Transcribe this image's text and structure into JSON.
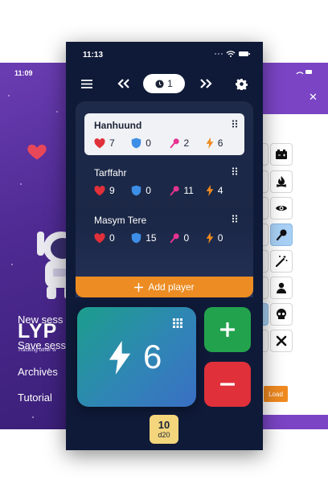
{
  "back_left": {
    "time": "11:09",
    "brand": "LYP",
    "tagline": "Tracking other w",
    "menu": [
      "New sess",
      "Save sess",
      "Archives",
      "Tutorial"
    ]
  },
  "back_right": {
    "close_label": "✕",
    "load_label": "Load",
    "icons": [
      "battery-icon",
      "campfire-icon",
      "eye-icon",
      "torch-icon",
      "magic-wand-icon",
      "user-icon",
      "skull-icon",
      "close-icon"
    ],
    "selected_icon": "torch-icon",
    "accent": "#7a44c4"
  },
  "main": {
    "time": "11:13",
    "timer_value": "1",
    "players": [
      {
        "name": "Hanhuund",
        "active": true,
        "hp": "7",
        "shield": "0",
        "torch": "2",
        "energy": "6"
      },
      {
        "name": "Tarffahr",
        "active": false,
        "hp": "9",
        "shield": "0",
        "torch": "11",
        "energy": "4"
      },
      {
        "name": "Masym Tere",
        "active": false,
        "hp": "0",
        "shield": "15",
        "torch": "0",
        "energy": "0"
      }
    ],
    "add_player_label": "Add player",
    "selected_stat_value": "6",
    "dice_value": "10",
    "dice_label": "d20",
    "colors": {
      "background": "#0f1a38",
      "heart": "#e0303a",
      "shield": "#3d8ee6",
      "torch": "#e6338f",
      "energy": "#f08a20",
      "plus": "#23a24d",
      "minus": "#e0303a",
      "add_player": "#ec8c23",
      "dice": "#f3d57c"
    }
  }
}
